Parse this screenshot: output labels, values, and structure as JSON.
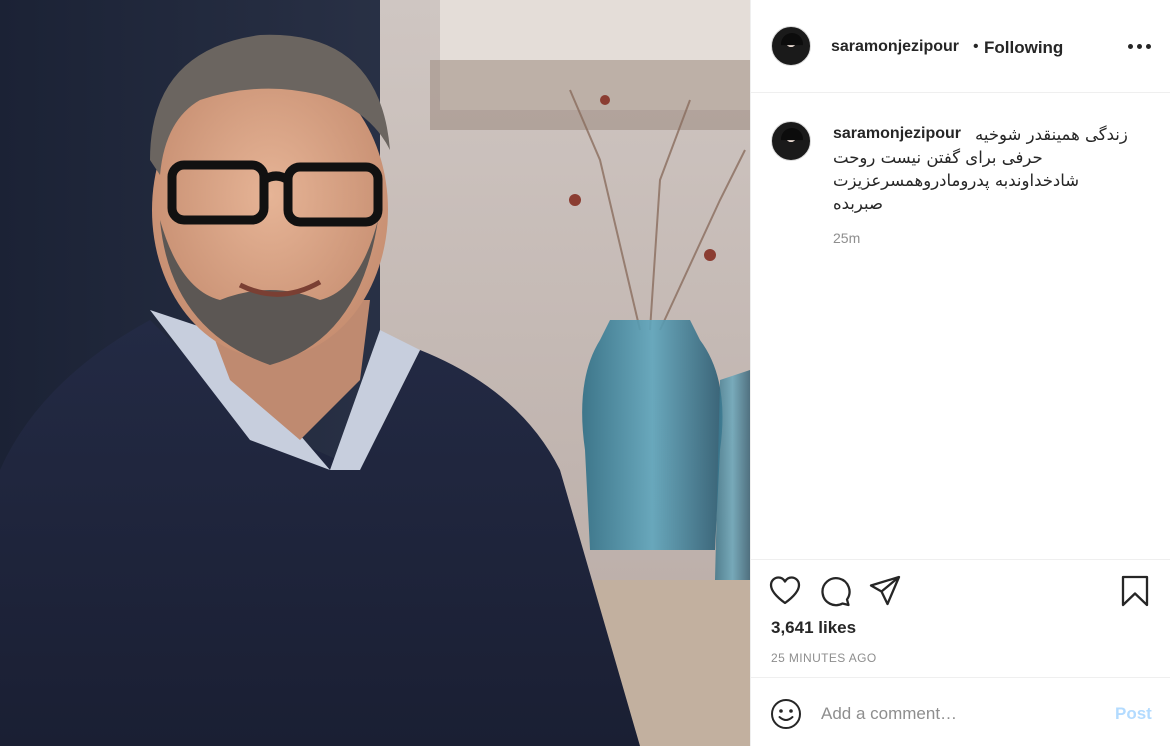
{
  "post": {
    "image_alt": "",
    "colors": {
      "accent_post_disabled": "#b3dbff",
      "muted": "#8e8e8e",
      "text": "#262626"
    }
  },
  "header": {
    "username": "saramonjezipour",
    "separator": "•",
    "follow_status": "Following",
    "more_icon": "more-horizontal-icon"
  },
  "caption": {
    "username": "saramonjezipour",
    "text": "زندگی همینقدر شوخیه\nحرفی برای گفتن نیست روحت\nشادخداوندبه پدرومادروهمسرعزیزت\nصبربده",
    "time": "25m"
  },
  "actions": {
    "like_icon": "heart-icon",
    "comment_icon": "comment-icon",
    "share_icon": "paper-plane-icon",
    "save_icon": "bookmark-icon",
    "likes": "3,641 likes",
    "time_ago": "25 minutes ago"
  },
  "comment_bar": {
    "emoji_icon": "smiley-icon",
    "placeholder": "Add a comment…",
    "value": "",
    "post_label": "Post"
  }
}
